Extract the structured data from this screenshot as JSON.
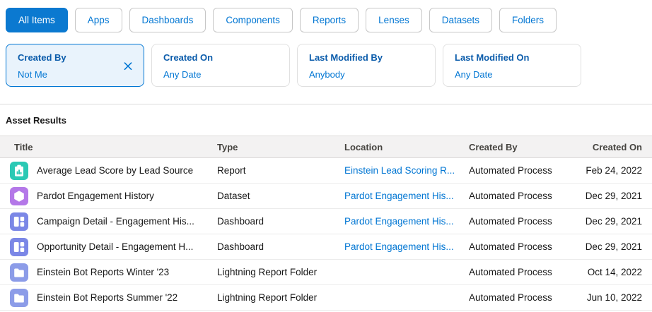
{
  "colors": {
    "brand_blue": "#0176d3",
    "dark_blue": "#0b5cab",
    "selected_tab_bg": "#0b79d0",
    "selected_filter_bg": "#e9f3fc",
    "header_bg": "#f3f2f2",
    "report_icon": "#2bc9b4",
    "dataset_icon": "#b478e8",
    "dashboard_icon": "#7b87e6",
    "folder_icon": "#8c9ce8"
  },
  "tabs": [
    {
      "label": "All Items",
      "selected": true
    },
    {
      "label": "Apps",
      "selected": false
    },
    {
      "label": "Dashboards",
      "selected": false
    },
    {
      "label": "Components",
      "selected": false
    },
    {
      "label": "Reports",
      "selected": false
    },
    {
      "label": "Lenses",
      "selected": false
    },
    {
      "label": "Datasets",
      "selected": false
    },
    {
      "label": "Folders",
      "selected": false
    }
  ],
  "filters": [
    {
      "title": "Created By",
      "value": "Not Me",
      "selected": true,
      "closable": true
    },
    {
      "title": "Created On",
      "value": "Any Date",
      "selected": false,
      "closable": false
    },
    {
      "title": "Last Modified By",
      "value": "Anybody",
      "selected": false,
      "closable": false
    },
    {
      "title": "Last Modified On",
      "value": "Any Date",
      "selected": false,
      "closable": false
    }
  ],
  "results": {
    "heading": "Asset Results",
    "columns": [
      "Title",
      "Type",
      "Location",
      "Created By",
      "Created On"
    ],
    "rows": [
      {
        "icon": "report-icon",
        "icon_color": "#2bc9b4",
        "title": "Average Lead Score by Lead Source",
        "type": "Report",
        "location": "Einstein Lead Scoring R...",
        "created_by": "Automated Process",
        "created_on": "Feb 24, 2022"
      },
      {
        "icon": "dataset-icon",
        "icon_color": "#b478e8",
        "title": "Pardot Engagement History",
        "type": "Dataset",
        "location": "Pardot Engagement His...",
        "created_by": "Automated Process",
        "created_on": "Dec 29, 2021"
      },
      {
        "icon": "dashboard-icon",
        "icon_color": "#7b87e6",
        "title": "Campaign Detail - Engagement His...",
        "type": "Dashboard",
        "location": "Pardot Engagement His...",
        "created_by": "Automated Process",
        "created_on": "Dec 29, 2021"
      },
      {
        "icon": "dashboard-icon",
        "icon_color": "#7b87e6",
        "title": "Opportunity Detail - Engagement H...",
        "type": "Dashboard",
        "location": "Pardot Engagement His...",
        "created_by": "Automated Process",
        "created_on": "Dec 29, 2021"
      },
      {
        "icon": "folder-icon",
        "icon_color": "#8c9ce8",
        "title": "Einstein Bot Reports Winter '23",
        "type": "Lightning Report Folder",
        "location": "",
        "created_by": "Automated Process",
        "created_on": "Oct 14, 2022"
      },
      {
        "icon": "folder-icon",
        "icon_color": "#8c9ce8",
        "title": "Einstein Bot Reports Summer '22",
        "type": "Lightning Report Folder",
        "location": "",
        "created_by": "Automated Process",
        "created_on": "Jun 10, 2022"
      }
    ]
  }
}
